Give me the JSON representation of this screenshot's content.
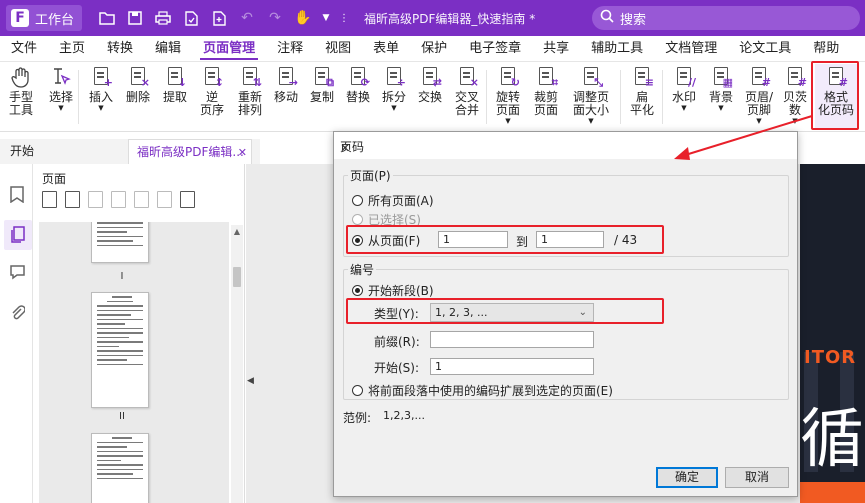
{
  "titlebar": {
    "workspace_label": "工作台",
    "document_title": "福昕高级PDF编辑器_快速指南 *",
    "search_placeholder": "搜索"
  },
  "menubar": {
    "items": [
      "文件",
      "主页",
      "转换",
      "编辑",
      "页面管理",
      "注释",
      "视图",
      "表单",
      "保护",
      "电子签章",
      "共享",
      "辅助工具",
      "文档管理",
      "论文工具",
      "帮助"
    ],
    "active": "页面管理"
  },
  "ribbon": {
    "tools": [
      {
        "label": "手型\n工具",
        "icon": "hand-icon"
      },
      {
        "label": "选择",
        "icon": "select-cursor-icon",
        "dropdown": true
      },
      {
        "label": "插入",
        "icon": "insert-page-icon",
        "dropdown": true
      },
      {
        "label": "删除",
        "icon": "delete-page-icon"
      },
      {
        "label": "提取",
        "icon": "extract-page-icon"
      },
      {
        "label": "逆\n页序",
        "icon": "reverse-order-icon"
      },
      {
        "label": "重新\n排列",
        "icon": "rearrange-icon"
      },
      {
        "label": "移动",
        "icon": "move-page-icon"
      },
      {
        "label": "复制",
        "icon": "copy-page-icon"
      },
      {
        "label": "替换",
        "icon": "replace-page-icon"
      },
      {
        "label": "拆分",
        "icon": "split-icon",
        "dropdown": true
      },
      {
        "label": "交换",
        "icon": "swap-icon"
      },
      {
        "label": "交叉\n合并",
        "icon": "cross-merge-icon"
      },
      {
        "label": "旋转\n页面",
        "icon": "rotate-page-icon",
        "dropdown": true
      },
      {
        "label": "裁剪\n页面",
        "icon": "crop-page-icon"
      },
      {
        "label": "调整页\n面大小",
        "icon": "resize-page-icon",
        "dropdown": true
      },
      {
        "label": "扁\n平化",
        "icon": "flatten-icon"
      },
      {
        "label": "水印",
        "icon": "watermark-icon",
        "dropdown": true
      },
      {
        "label": "背景",
        "icon": "background-icon",
        "dropdown": true
      },
      {
        "label": "页眉/\n页脚",
        "icon": "header-footer-icon",
        "dropdown": true
      },
      {
        "label": "贝茨\n数",
        "icon": "bates-number-icon",
        "dropdown": true
      },
      {
        "label": "格式\n化页码",
        "icon": "format-page-number-icon"
      }
    ]
  },
  "tabs": [
    {
      "label": "开始"
    },
    {
      "label": "福昕高级PDF编辑...",
      "closable": true
    }
  ],
  "page_panel": {
    "title": "页面",
    "thumbnail_labels": [
      "I",
      "II"
    ]
  },
  "cover": {
    "text": "ITOR",
    "char": "循"
  },
  "dialog": {
    "title": "页码",
    "page_group": {
      "label": "页面(P)",
      "all_pages": "所有页面(A)",
      "selected": "已选择(S)",
      "from_page": "从页面(F)",
      "from_value": "1",
      "to_label": "到",
      "to_value": "1",
      "total": "/ 43"
    },
    "numbering_group": {
      "label": "编号",
      "start_new_section": "开始新段(B)",
      "type_label": "类型(Y):",
      "type_value": "1, 2, 3, ...",
      "prefix_label": "前缀(R):",
      "prefix_value": "",
      "start_label": "开始(S):",
      "start_value": "1",
      "extend_label": "将前面段落中使用的编码扩展到选定的页面(E)"
    },
    "example_label": "范例:",
    "example_value": "1,2,3,...",
    "ok_label": "确定",
    "cancel_label": "取消"
  },
  "colors": {
    "brand": "#7b2fc4",
    "annotation_red": "#e8202a",
    "cover_orange": "#f15a22"
  }
}
